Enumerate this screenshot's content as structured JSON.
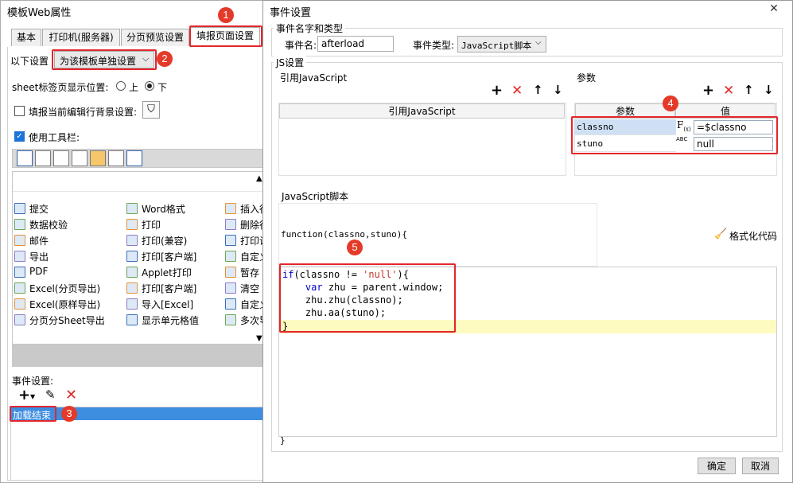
{
  "left_window": {
    "title": "模板Web属性",
    "tabs": [
      "基本",
      "打印机(服务器)",
      "分页预览设置",
      "填报页面设置"
    ],
    "settings_label": "以下设置",
    "settings_select": "为该模板单独设置",
    "sheet_tab_label": "sheet标签页显示位置:",
    "radio_top": "上",
    "radio_bottom": "下",
    "fill_bg_label": "填报当前编辑行背景设置:",
    "use_toolbar_label": "使用工具栏:",
    "toolbar_items": [
      [
        "提交",
        "Word格式",
        "插入行"
      ],
      [
        "数据校验",
        "打印",
        "删除行"
      ],
      [
        "邮件",
        "打印(兼容)",
        "打印设"
      ],
      [
        "导出",
        "打印[客户端]",
        "自定义"
      ],
      [
        "PDF",
        "Applet打印",
        "暂存"
      ],
      [
        "Excel(分页导出)",
        "打印[客户端]",
        "清空"
      ],
      [
        "Excel(原样导出)",
        "导入[Excel]",
        "自定义"
      ],
      [
        "分页分Sheet导出",
        "显示单元格值",
        "多次导"
      ]
    ],
    "event_settings_label": "事件设置:",
    "event_item": "加载结束"
  },
  "right_window": {
    "title": "事件设置",
    "event_group_title": "事件名字和类型",
    "event_name_label": "事件名:",
    "event_name_value": "afterload",
    "event_type_label": "事件类型:",
    "event_type_value": "JavaScript脚本",
    "js_group_title": "JS设置",
    "ref_js_title": "引用JavaScript",
    "ref_js_header": "引用JavaScript",
    "params_title": "参数",
    "params_col_param": "参数",
    "params_col_value": "值",
    "params": [
      {
        "name": "classno",
        "value": "=$classno"
      },
      {
        "name": "stuno",
        "value": "null"
      }
    ],
    "js_script_title": "JavaScript脚本",
    "function_signature": "function(classno,stuno){",
    "format_code_label": "格式化代码",
    "code_lines": [
      "if(classno != 'null'){",
      "    var zhu = parent.window;",
      "    zhu.zhu(classno);",
      "    zhu.aa(stuno);",
      "}"
    ],
    "closing_brace": "}",
    "ok_label": "确定",
    "cancel_label": "取消"
  },
  "badges": [
    "1",
    "2",
    "3",
    "4",
    "5"
  ],
  "colors": {
    "accent": "#1b73d8",
    "highlight_red": "#e3262b",
    "selected_row": "#3d8de0"
  }
}
